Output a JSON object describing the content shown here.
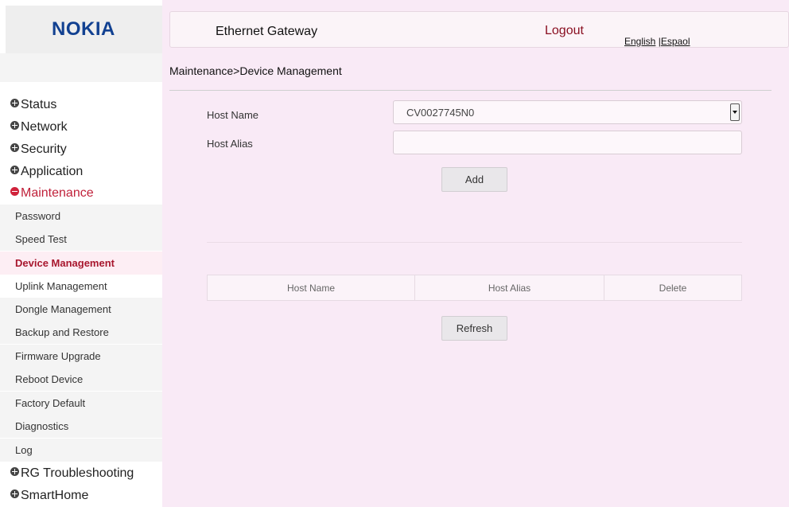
{
  "brand": {
    "logo_text": "NOKIA",
    "logo_color": "#124191"
  },
  "header": {
    "title": "Ethernet Gateway",
    "logout": "Logout",
    "lang_english": "English",
    "lang_sep": "|",
    "lang_spanish": "Espaol"
  },
  "breadcrumb": "Maintenance>Device Management",
  "sidebar": {
    "top_items": [
      {
        "label": "Status",
        "icon": "plus-icon"
      },
      {
        "label": "Network",
        "icon": "plus-icon"
      },
      {
        "label": "Security",
        "icon": "plus-icon"
      },
      {
        "label": "Application",
        "icon": "plus-icon"
      },
      {
        "label": "Maintenance",
        "icon": "minus-icon",
        "expanded": true
      }
    ],
    "sub_items": [
      {
        "label": "Password"
      },
      {
        "label": "Speed Test"
      },
      {
        "label": "Device Management",
        "selected": true
      },
      {
        "label": "Uplink Management"
      },
      {
        "label": "Dongle Management"
      },
      {
        "label": "Backup and Restore"
      },
      {
        "label": "Firmware Upgrade"
      },
      {
        "label": "Reboot Device"
      },
      {
        "label": "Factory Default"
      },
      {
        "label": "Diagnostics"
      },
      {
        "label": "Log"
      }
    ],
    "bottom_items": [
      {
        "label": "RG Troubleshooting",
        "icon": "plus-icon"
      },
      {
        "label": "SmartHome",
        "icon": "plus-icon"
      }
    ]
  },
  "form": {
    "host_name_label": "Host Name",
    "host_name_value": "CV0027745N0",
    "host_alias_label": "Host Alias",
    "host_alias_value": "",
    "add_button": "Add"
  },
  "table": {
    "columns": [
      "Host Name",
      "Host Alias",
      "Delete"
    ],
    "rows": []
  },
  "refresh_button": "Refresh",
  "colors": {
    "accent": "#c0213a",
    "logout": "#8a1022",
    "main_bg": "#f9eaf6"
  }
}
